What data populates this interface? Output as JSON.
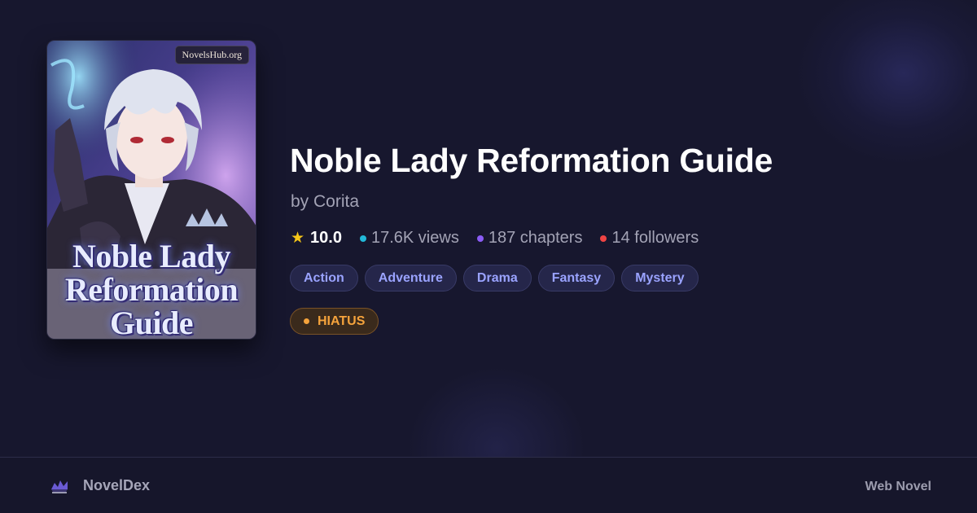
{
  "novel": {
    "title": "Noble Lady Reformation Guide",
    "author": "by Corita",
    "rating": "10.0",
    "views": "17.6K views",
    "chapters": "187 chapters",
    "followers": "14 followers",
    "status": "HIATUS"
  },
  "cover": {
    "watermark": "NovelsHub.org",
    "title": "Noble Lady Reformation Guide"
  },
  "tags": [
    "Action",
    "Adventure",
    "Drama",
    "Fantasy",
    "Mystery"
  ],
  "footer": {
    "brand": "NovelDex",
    "type_label": "Web Novel"
  },
  "icons": {
    "rating": "star-icon",
    "views": "cyan-dot-icon",
    "chapters": "purple-dot-icon",
    "followers": "red-dot-icon"
  },
  "colors": {
    "background": "#17172e",
    "star": "#f5c518",
    "views_dot": "#22b8d8",
    "chapters_dot": "#8b5cf6",
    "followers_dot": "#ef4444",
    "tag_text": "#9aa3ff",
    "status": "#f5a33c"
  }
}
